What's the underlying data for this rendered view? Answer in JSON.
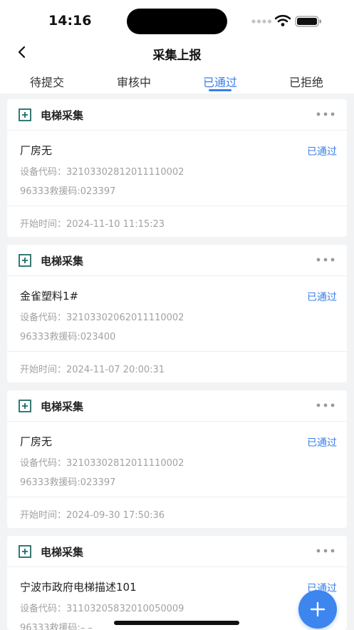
{
  "status_bar": {
    "time": "14:16"
  },
  "nav": {
    "title": "采集上报"
  },
  "tabs": [
    {
      "label": "待提交",
      "active": false
    },
    {
      "label": "审核中",
      "active": false
    },
    {
      "label": "已通过",
      "active": true
    },
    {
      "label": "已拒绝",
      "active": false
    }
  ],
  "cards": [
    {
      "title": "电梯采集",
      "name": "厂房无",
      "status": "已通过",
      "device_code": "设备代码：32103302812011110002",
      "rescue_code": "96333救援码:023397",
      "start_time": "开始时间：2024-11-10 11:15:23"
    },
    {
      "title": "电梯采集",
      "name": "金雀塑料1#",
      "status": "已通过",
      "device_code": "设备代码：32103302062011110002",
      "rescue_code": "96333救援码:023400",
      "start_time": "开始时间：2024-11-07 20:00:31"
    },
    {
      "title": "电梯采集",
      "name": "厂房无",
      "status": "已通过",
      "device_code": "设备代码：32103302812011110002",
      "rescue_code": "96333救援码:023397",
      "start_time": "开始时间：2024-09-30 17:50:36"
    },
    {
      "title": "电梯采集",
      "name": "宁波市政府电梯描述101",
      "status": "已通过",
      "device_code": "设备代码：31103205832010050009",
      "rescue_code": "96333救援码:– –",
      "start_time": ""
    }
  ],
  "icons": {
    "back": "chevron-left-icon",
    "card_header": "plus-box-icon",
    "card_menu": "more-dots-icon",
    "fab": "plus-icon"
  },
  "colors": {
    "accent": "#3a7ee8",
    "fab": "#3d85ef",
    "muted_text": "#a2a2a2",
    "page_bg": "#f2f3f5",
    "icon_green": "#1f6b66"
  }
}
